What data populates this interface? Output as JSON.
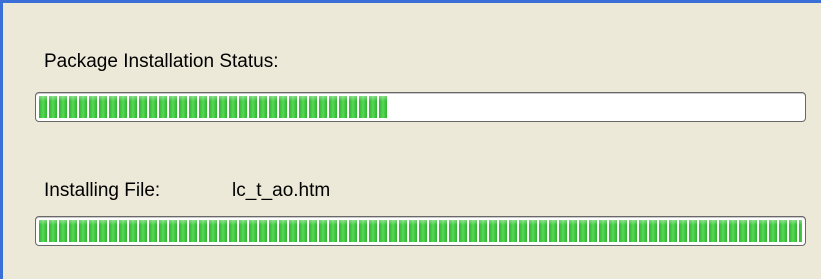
{
  "package_status": {
    "label": "Package Installation Status:",
    "progress_fraction": 0.46
  },
  "installing_file": {
    "label": "Installing File:",
    "file_name": "lc_t_ao.htm",
    "progress_fraction": 1.0
  },
  "colors": {
    "background": "#ece9d8",
    "accent_border": "#3a6fd8",
    "progress_green": "#2fb52f"
  }
}
